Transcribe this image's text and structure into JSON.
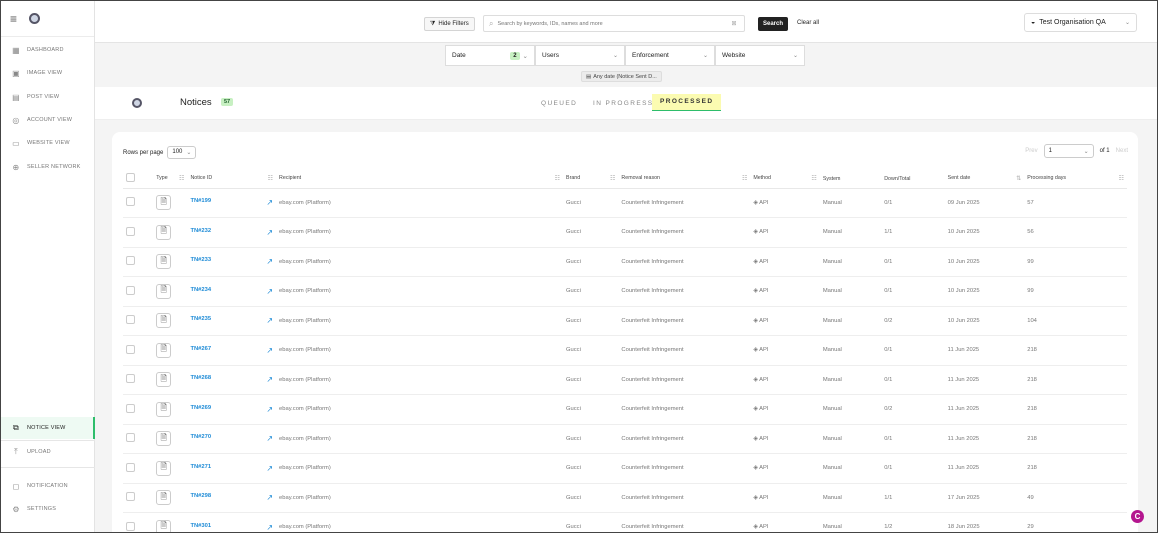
{
  "sidebar": {
    "items": [
      {
        "label": "DASHBOARD",
        "icon": "dashboard-icon"
      },
      {
        "label": "IMAGE VIEW",
        "icon": "image-icon"
      },
      {
        "label": "POST VIEW",
        "icon": "post-icon"
      },
      {
        "label": "ACCOUNT VIEW",
        "icon": "account-icon"
      },
      {
        "label": "WEBSITE VIEW",
        "icon": "website-icon"
      },
      {
        "label": "SELLER NETWORK",
        "icon": "network-icon"
      }
    ],
    "bottom_items": [
      {
        "label": "NOTICE VIEW",
        "icon": "notice-icon",
        "active": true
      },
      {
        "label": "UPLOAD",
        "icon": "upload-icon"
      },
      {
        "label": "NOTIFICATION",
        "icon": "bell-icon"
      },
      {
        "label": "SETTINGS",
        "icon": "gear-icon"
      }
    ]
  },
  "topbar": {
    "hide_filters": "Hide Filters",
    "search_placeholder": "Search by keywords, IDs, names and more",
    "search_button": "Search",
    "clear_all": "Clear all",
    "organisation": "Test Organisation QA"
  },
  "filters": {
    "date": "Date",
    "date_count": "2",
    "users": "Users",
    "enforcement": "Enforcement",
    "website": "Website",
    "chip": "Any date (Notice Sent D..."
  },
  "title": {
    "page_title": "Notices",
    "count": "57",
    "tabs": [
      "QUEUED",
      "IN PROGRESS",
      "PROCESSED"
    ],
    "active_tab": "PROCESSED"
  },
  "table": {
    "rows_per_page_label": "Rows per page",
    "rows_per_page": "100",
    "prev": "Prev",
    "page": "1",
    "of": "of 1",
    "next": "Next",
    "columns": [
      "Type",
      "Notice ID",
      "Recipient",
      "Brand",
      "Removal reason",
      "Method",
      "System",
      "Down/Total",
      "Sent date",
      "Processing days"
    ],
    "rows": [
      {
        "id": "TN#199",
        "recipient": "ebay.com (Platform)",
        "brand": "Gucci",
        "reason": "Counterfeit Infringement",
        "method": "API",
        "system": "Manual",
        "down_total": "0/1",
        "sent": "09 Jun 2025",
        "days": "57"
      },
      {
        "id": "TN#232",
        "recipient": "ebay.com (Platform)",
        "brand": "Gucci",
        "reason": "Counterfeit Infringement",
        "method": "API",
        "system": "Manual",
        "down_total": "1/1",
        "sent": "10 Jun 2025",
        "days": "56"
      },
      {
        "id": "TN#233",
        "recipient": "ebay.com (Platform)",
        "brand": "Gucci",
        "reason": "Counterfeit Infringement",
        "method": "API",
        "system": "Manual",
        "down_total": "0/1",
        "sent": "10 Jun 2025",
        "days": "99"
      },
      {
        "id": "TN#234",
        "recipient": "ebay.com (Platform)",
        "brand": "Gucci",
        "reason": "Counterfeit Infringement",
        "method": "API",
        "system": "Manual",
        "down_total": "0/1",
        "sent": "10 Jun 2025",
        "days": "99"
      },
      {
        "id": "TN#235",
        "recipient": "ebay.com (Platform)",
        "brand": "Gucci",
        "reason": "Counterfeit Infringement",
        "method": "API",
        "system": "Manual",
        "down_total": "0/2",
        "sent": "10 Jun 2025",
        "days": "104"
      },
      {
        "id": "TN#267",
        "recipient": "ebay.com (Platform)",
        "brand": "Gucci",
        "reason": "Counterfeit Infringement",
        "method": "API",
        "system": "Manual",
        "down_total": "0/1",
        "sent": "11 Jun 2025",
        "days": "218"
      },
      {
        "id": "TN#268",
        "recipient": "ebay.com (Platform)",
        "brand": "Gucci",
        "reason": "Counterfeit Infringement",
        "method": "API",
        "system": "Manual",
        "down_total": "0/1",
        "sent": "11 Jun 2025",
        "days": "218"
      },
      {
        "id": "TN#269",
        "recipient": "ebay.com (Platform)",
        "brand": "Gucci",
        "reason": "Counterfeit Infringement",
        "method": "API",
        "system": "Manual",
        "down_total": "0/2",
        "sent": "11 Jun 2025",
        "days": "218"
      },
      {
        "id": "TN#270",
        "recipient": "ebay.com (Platform)",
        "brand": "Gucci",
        "reason": "Counterfeit Infringement",
        "method": "API",
        "system": "Manual",
        "down_total": "0/1",
        "sent": "11 Jun 2025",
        "days": "218"
      },
      {
        "id": "TN#271",
        "recipient": "ebay.com (Platform)",
        "brand": "Gucci",
        "reason": "Counterfeit Infringement",
        "method": "API",
        "system": "Manual",
        "down_total": "0/1",
        "sent": "11 Jun 2025",
        "days": "218"
      },
      {
        "id": "TN#298",
        "recipient": "ebay.com (Platform)",
        "brand": "Gucci",
        "reason": "Counterfeit Infringement",
        "method": "API",
        "system": "Manual",
        "down_total": "1/1",
        "sent": "17 Jun 2025",
        "days": "49"
      },
      {
        "id": "TN#301",
        "recipient": "ebay.com (Platform)",
        "brand": "Gucci",
        "reason": "Counterfeit Infringement",
        "method": "API",
        "system": "Manual",
        "down_total": "1/2",
        "sent": "18 Jun 2025",
        "days": "29"
      }
    ]
  },
  "fab": "C",
  "colors": {
    "accent": "#2ebd6b",
    "link": "#1c8ad6",
    "highlight": "#fbfbb1",
    "fab": "#b4168f"
  }
}
